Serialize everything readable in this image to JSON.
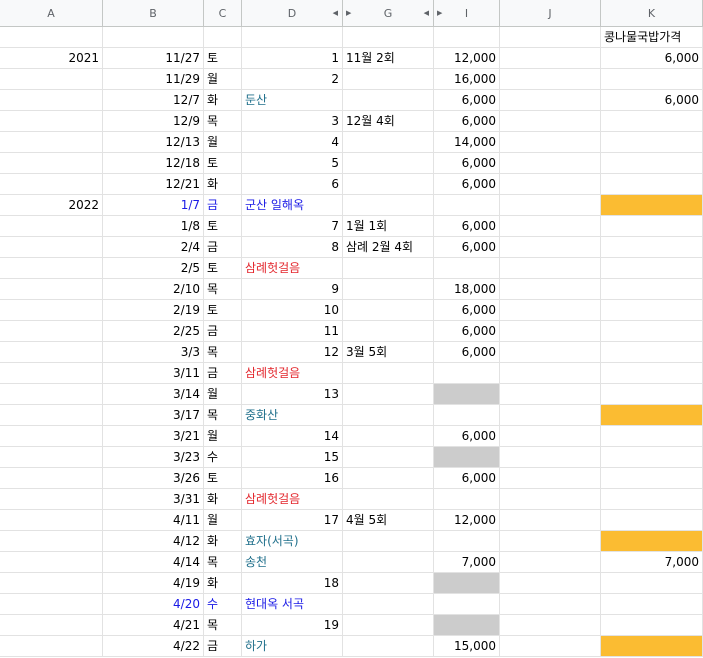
{
  "columns": [
    "A",
    "B",
    "C",
    "D",
    "G",
    "I",
    "J",
    "K"
  ],
  "header_row": {
    "K": "콩나물국밥가격"
  },
  "rows": [
    {
      "A": "2021",
      "B": "11/27",
      "C": "토",
      "D": "1",
      "G": "11월 2회",
      "I": "12,000",
      "K": "6,000"
    },
    {
      "B": "11/29",
      "C": "월",
      "D": "2",
      "I": "16,000"
    },
    {
      "B": "12/7",
      "C": "화",
      "Dtext": "둔산",
      "Dcolor": "teal",
      "I": "6,000",
      "K": "6,000"
    },
    {
      "B": "12/9",
      "C": "목",
      "D": "3",
      "G": "12월 4회",
      "I": "6,000"
    },
    {
      "B": "12/13",
      "C": "월",
      "D": "4",
      "I": "14,000"
    },
    {
      "B": "12/18",
      "C": "토",
      "D": "5",
      "I": "6,000"
    },
    {
      "B": "12/21",
      "C": "화",
      "D": "6",
      "I": "6,000"
    },
    {
      "A": "2022",
      "B": "1/7",
      "C": "금",
      "Bcolor": "blue",
      "Dtext": "군산 일해옥",
      "Dcolor": "blue",
      "Kfill": "orange"
    },
    {
      "B": "1/8",
      "C": "토",
      "D": "7",
      "G": "1월 1회",
      "I": "6,000"
    },
    {
      "B": "2/4",
      "C": "금",
      "D": "8",
      "G": "삼례 2월 4회",
      "I": "6,000"
    },
    {
      "B": "2/5",
      "C": "토",
      "Dtext": "삼례헛걸음",
      "Dcolor": "red"
    },
    {
      "B": "2/10",
      "C": "목",
      "D": "9",
      "I": "18,000"
    },
    {
      "B": "2/19",
      "C": "토",
      "D": "10",
      "I": "6,000"
    },
    {
      "B": "2/25",
      "C": "금",
      "D": "11",
      "I": "6,000"
    },
    {
      "B": "3/3",
      "C": "목",
      "D": "12",
      "G": "3월 5회",
      "I": "6,000"
    },
    {
      "B": "3/11",
      "C": "금",
      "Dtext": "삼례헛걸음",
      "Dcolor": "red"
    },
    {
      "B": "3/14",
      "C": "월",
      "D": "13",
      "Ifill": "gray"
    },
    {
      "B": "3/17",
      "C": "목",
      "Dtext": "중화산",
      "Dcolor": "teal",
      "Kfill": "orange"
    },
    {
      "B": "3/21",
      "C": "월",
      "D": "14",
      "I": "6,000"
    },
    {
      "B": "3/23",
      "C": "수",
      "D": "15",
      "Ifill": "gray"
    },
    {
      "B": "3/26",
      "C": "토",
      "D": "16",
      "I": "6,000"
    },
    {
      "B": "3/31",
      "C": "화",
      "Dtext": "삼례헛걸음",
      "Dcolor": "red"
    },
    {
      "B": "4/11",
      "C": "월",
      "D": "17",
      "G": "4월 5회",
      "I": "12,000"
    },
    {
      "B": "4/12",
      "C": "화",
      "Dtext": "효자(서곡)",
      "Dcolor": "teal",
      "Kfill": "orange"
    },
    {
      "B": "4/14",
      "C": "목",
      "Dtext": "송천",
      "Dcolor": "teal",
      "I": "7,000",
      "K": "7,000"
    },
    {
      "B": "4/19",
      "C": "화",
      "D": "18",
      "Ifill": "gray"
    },
    {
      "B": "4/20",
      "C": "수",
      "Bcolor": "blue",
      "Dtext": "현대옥 서곡",
      "Dcolor": "blue"
    },
    {
      "B": "4/21",
      "C": "목",
      "D": "19",
      "Ifill": "gray"
    },
    {
      "B": "4/22",
      "C": "금",
      "Dtext": "하가",
      "Dcolor": "teal",
      "I": "15,000",
      "Kfill": "orange"
    }
  ],
  "colors": {
    "orange": "#fbbc32",
    "gray": "#cccccc",
    "blue": "#1a1ae6",
    "teal": "#1f6f8b",
    "red": "#e3262c"
  }
}
